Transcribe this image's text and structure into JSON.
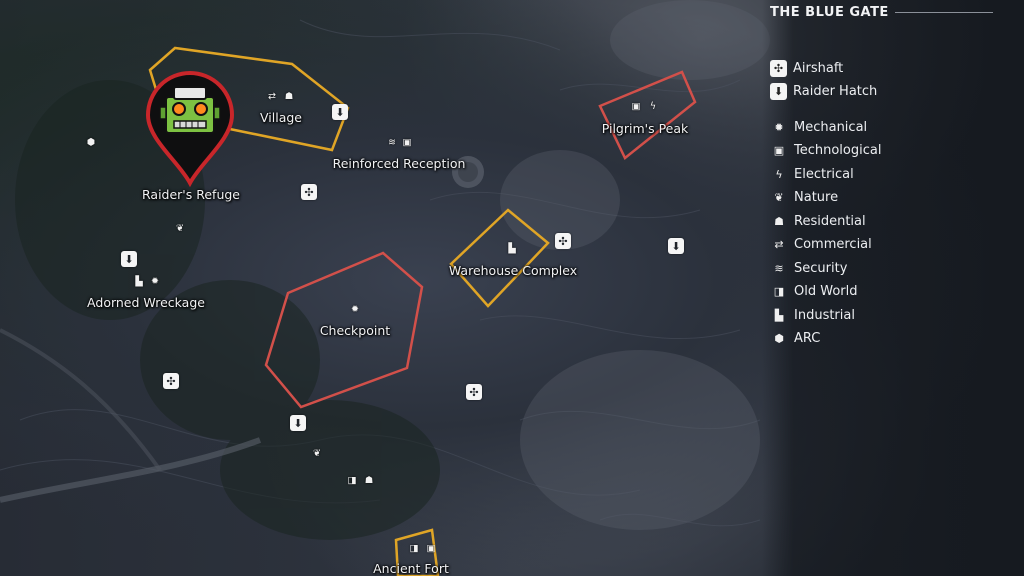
{
  "map": {
    "title": "THE BLUE GATE"
  },
  "legend": {
    "items": [
      {
        "label": "Airshaft",
        "icon": "airshaft-icon",
        "glyph": "✣",
        "boxed": true
      },
      {
        "label": "Raider Hatch",
        "icon": "raider-hatch-icon",
        "glyph": "⬇",
        "boxed": true
      },
      {
        "label": "Mechanical",
        "icon": "gear-icon",
        "glyph": "✹",
        "boxed": false
      },
      {
        "label": "Technological",
        "icon": "chip-icon",
        "glyph": "▣",
        "boxed": false
      },
      {
        "label": "Electrical",
        "icon": "lightning-icon",
        "glyph": "ϟ",
        "boxed": false
      },
      {
        "label": "Nature",
        "icon": "leaf-icon",
        "glyph": "❦",
        "boxed": false
      },
      {
        "label": "Residential",
        "icon": "person-icon",
        "glyph": "☗",
        "boxed": false
      },
      {
        "label": "Commercial",
        "icon": "exchange-icon",
        "glyph": "⇄",
        "boxed": false
      },
      {
        "label": "Security",
        "icon": "shield-stack-icon",
        "glyph": "≋",
        "boxed": false
      },
      {
        "label": "Old World",
        "icon": "book-icon",
        "glyph": "◨",
        "boxed": false
      },
      {
        "label": "Industrial",
        "icon": "factory-icon",
        "glyph": "▙",
        "boxed": false
      },
      {
        "label": "ARC",
        "icon": "arc-icon",
        "glyph": "⬢",
        "boxed": false
      }
    ]
  },
  "locations": {
    "village": "Village",
    "reinforced_reception": "Reinforced Reception",
    "raiders_refuge": "Raider's Refuge",
    "pilgrims_peak": "Pilgrim's Peak",
    "warehouse_complex": "Warehouse Complex",
    "adorned_wreckage": "Adorned Wreckage",
    "checkpoint": "Checkpoint",
    "ancient_fort": "Ancient Fort"
  },
  "colors": {
    "zone_yellow": "#e0a526",
    "zone_red": "#d2504a",
    "pin_red": "#c8262a",
    "robot_green": "#7dc142"
  }
}
